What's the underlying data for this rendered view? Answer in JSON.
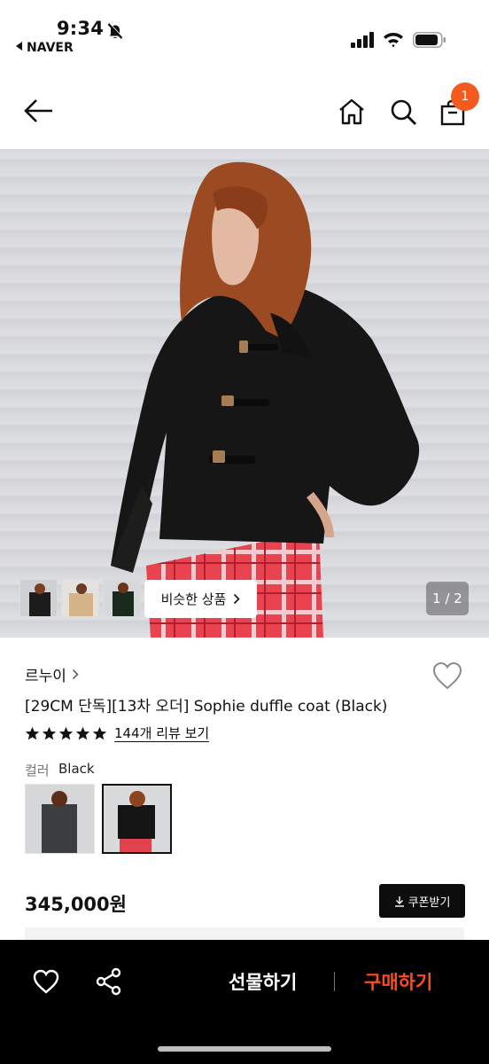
{
  "status_bar": {
    "time": "9:34",
    "back_app": "NAVER"
  },
  "nav": {
    "cart_count": "1"
  },
  "gallery": {
    "similar_label": "비슷한 상품",
    "pager": "1 / 2"
  },
  "product": {
    "brand": "르누이",
    "title": "[29CM 단독][13차 오더] Sophie duffle coat (Black)",
    "rating_stars": 5,
    "review_link": "144개 리뷰 보기",
    "option_label": "컬러",
    "option_value": "Black",
    "price": "345,000원",
    "coupon_label": "쿠폰받기"
  },
  "bottom_bar": {
    "gift_label": "선물하기",
    "buy_label": "구매하기"
  },
  "colors": {
    "accent": "#f25a1e",
    "buy": "#ff4b1f",
    "dark": "#0d0d0d"
  },
  "icons": [
    "bell-slash-icon",
    "signal-icon",
    "wifi-icon",
    "battery-icon",
    "back-arrow-icon",
    "home-icon",
    "search-icon",
    "cart-icon",
    "chevron-right-icon",
    "heart-icon",
    "star-icon",
    "download-icon",
    "share-icon"
  ]
}
